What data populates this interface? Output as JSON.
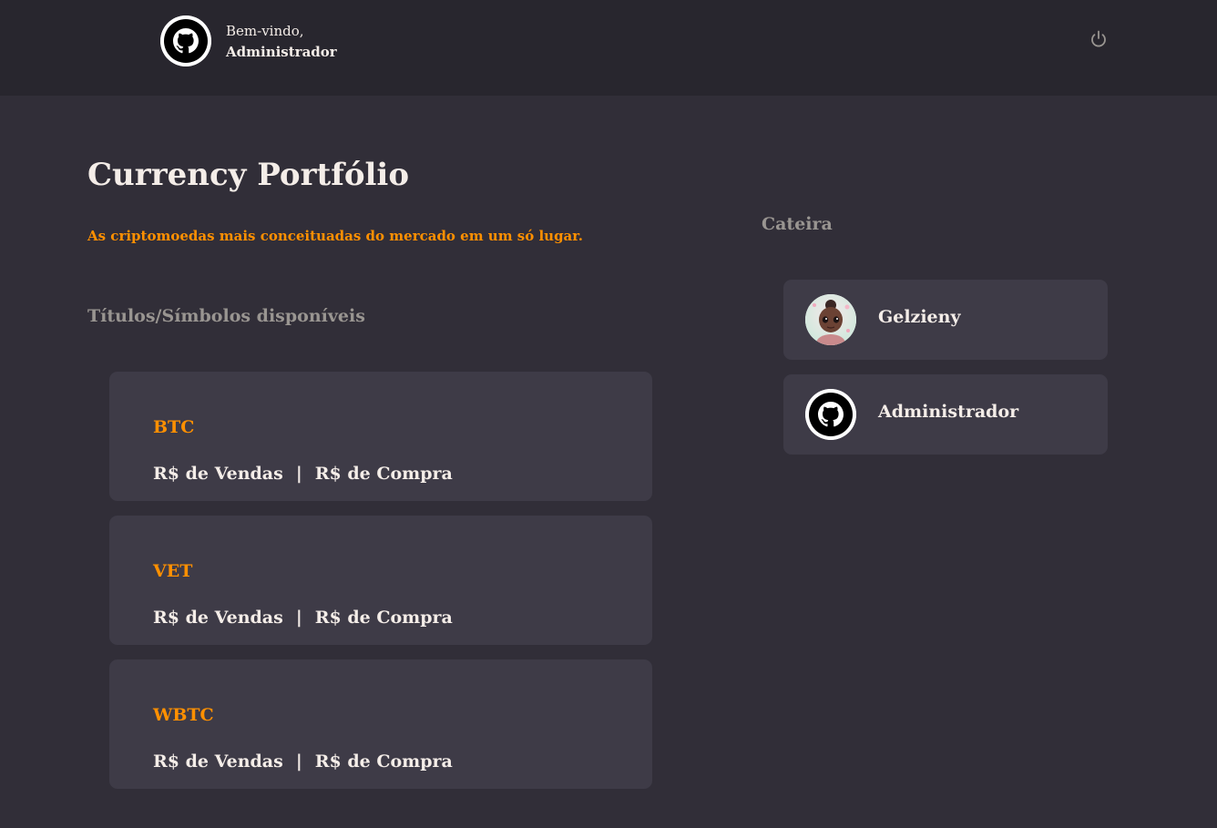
{
  "header": {
    "welcome_text": "Bem-vindo,",
    "user_name": "Administrador",
    "avatar_icon": "github-icon",
    "logout_icon": "power-icon"
  },
  "main": {
    "title": "Currency Portfólio",
    "subtitle": "As criptomoedas mais conceituadas do mercado em um só lugar.",
    "section_label": "Títulos/Símbolos disponíveis",
    "coins": [
      {
        "symbol": "BTC",
        "sell_label": "R$ de Vendas",
        "separator": "|",
        "buy_label": "R$ de Compra"
      },
      {
        "symbol": "VET",
        "sell_label": "R$ de Vendas",
        "separator": "|",
        "buy_label": "R$ de Compra"
      },
      {
        "symbol": "WBTC",
        "sell_label": "R$ de Vendas",
        "separator": "|",
        "buy_label": "R$ de Compra"
      }
    ]
  },
  "wallet": {
    "label": "Cateira",
    "users": [
      {
        "name": "Gelzieny",
        "avatar": "user-photo"
      },
      {
        "name": "Administrador",
        "avatar": "github-icon"
      }
    ]
  },
  "colors": {
    "background": "#312e38",
    "header_background": "#28262e",
    "card_background": "#3e3b47",
    "accent": "#ff9000",
    "text": "#f4ede8",
    "muted": "#999591"
  }
}
